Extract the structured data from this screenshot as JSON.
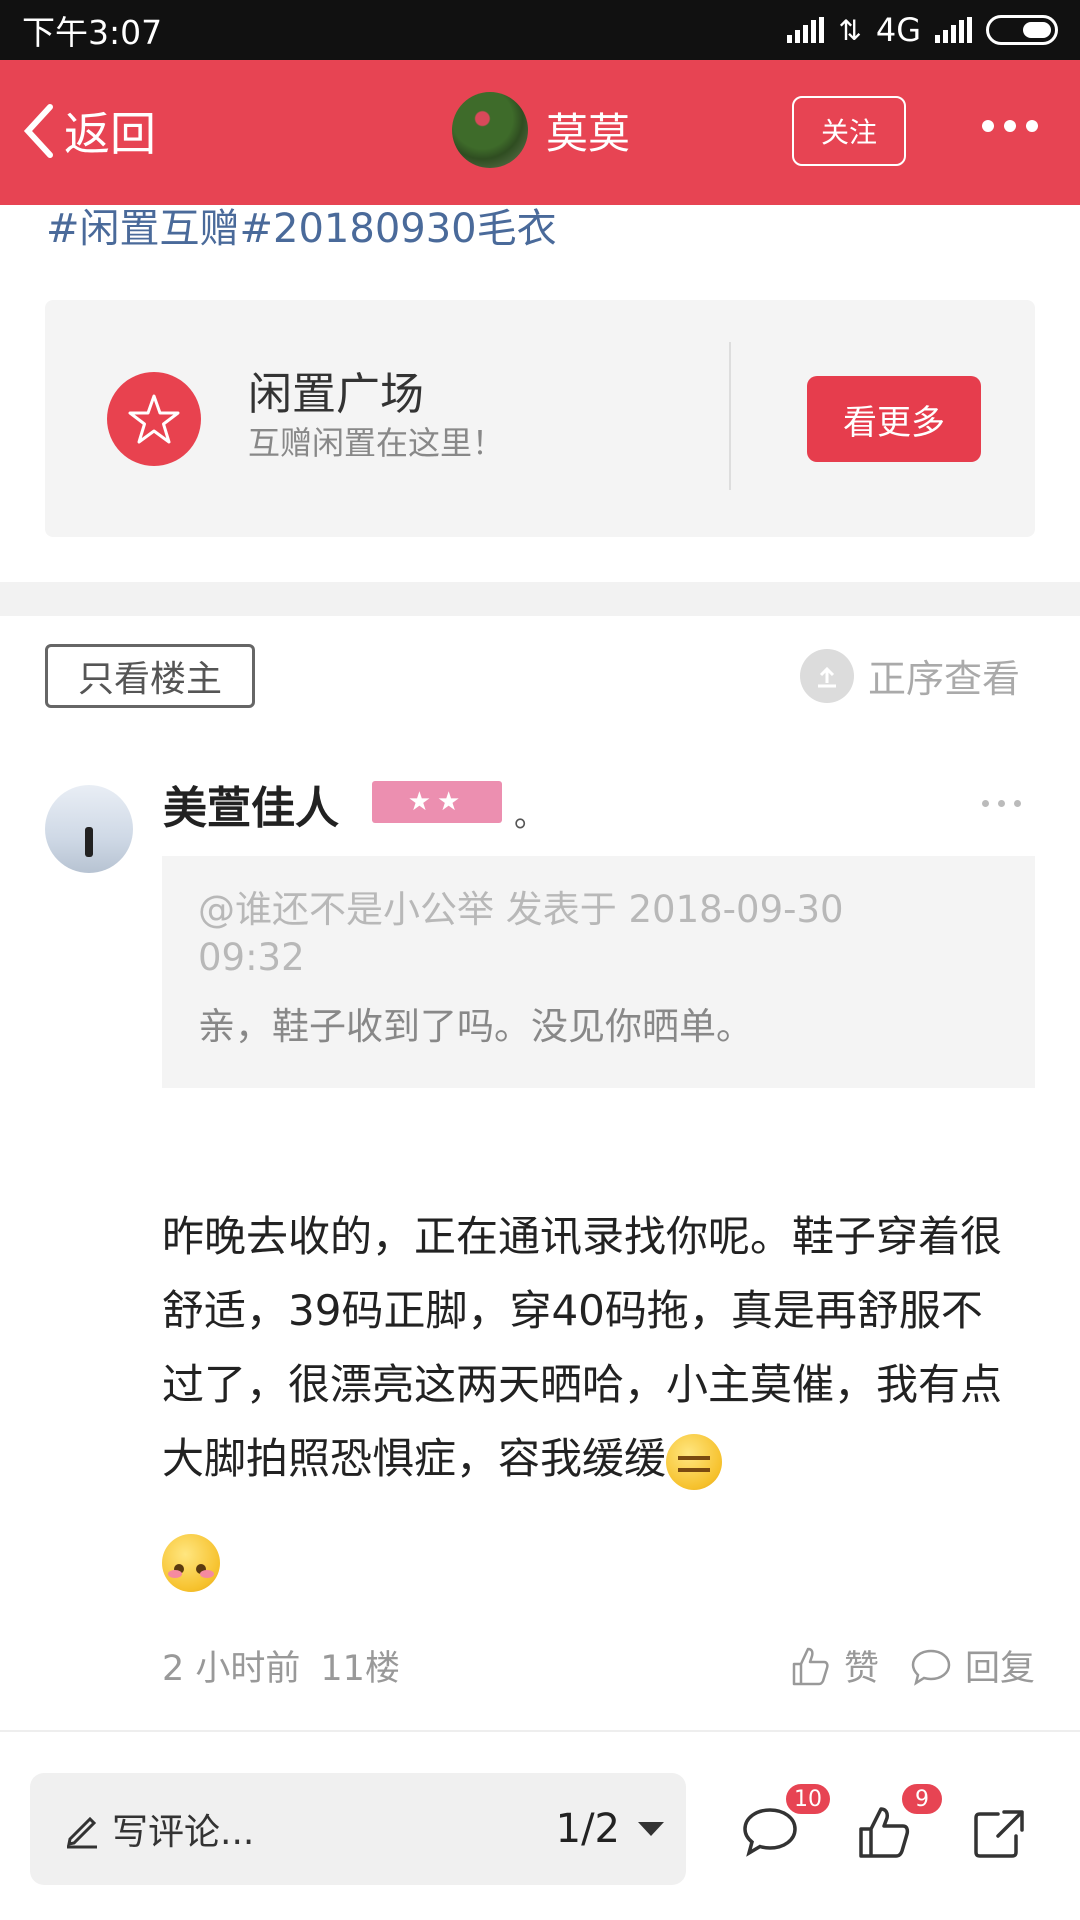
{
  "status_bar": {
    "time": "下午3:07",
    "network": "4G"
  },
  "header": {
    "back_label": "返回",
    "user_name": "莫莫",
    "follow_label": "关注"
  },
  "topic": "#闲置互赠#20180930毛衣",
  "square_card": {
    "title": "闲置广场",
    "subtitle": "互赠闲置在这里！",
    "more_label": "看更多"
  },
  "filter": {
    "only_owner_label": "只看楼主",
    "order_label": "正序查看"
  },
  "comment": {
    "author": "美萱佳人",
    "badge_stars": "★★",
    "name_suffix": "。",
    "quote": {
      "meta": "@谁还不是小公举 发表于 2018-09-30 09:32",
      "text": "亲，鞋子收到了吗。没见你晒单。"
    },
    "body": "昨晚去收的，正在通讯录找你呢。鞋子穿着很舒适，39码正脚，穿40码拖，真是再舒服不过了，很漂亮这两天晒哈，小主莫催，我有点大脚拍照恐惧症，容我缓缓",
    "emojis": [
      "cool-emoji",
      "blush-emoji"
    ],
    "time": "2 小时前",
    "floor": "11楼",
    "like_label": "赞",
    "reply_label": "回复"
  },
  "bottom_bar": {
    "write_placeholder": "写评论...",
    "page_indicator": "1/2",
    "comment_count": "10",
    "like_count": "9"
  },
  "colors": {
    "brand_red": "#e74453",
    "topic_blue": "#4a6a9a",
    "badge_pink": "#ec8fb0"
  }
}
